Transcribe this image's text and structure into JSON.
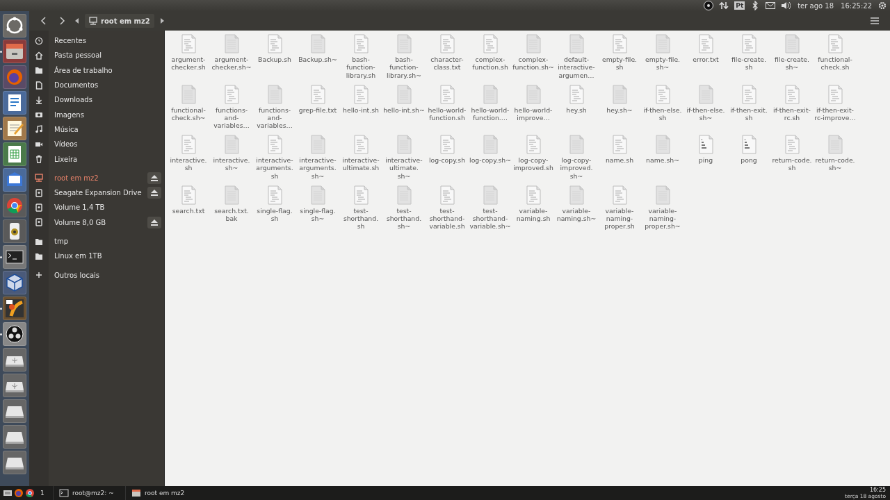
{
  "top_bar": {
    "indicators": [
      {
        "kind": "obs"
      },
      {
        "kind": "network"
      },
      {
        "kind": "keyboard",
        "label": "Pt"
      },
      {
        "kind": "bluetooth"
      },
      {
        "kind": "mail"
      },
      {
        "kind": "volume"
      }
    ],
    "date": "ter ago 18",
    "time": "16:25:22"
  },
  "launcher": [
    {
      "kind": "ubuntu",
      "running": false
    },
    {
      "kind": "files",
      "running": true
    },
    {
      "kind": "firefox",
      "running": false
    },
    {
      "kind": "writer",
      "running": false
    },
    {
      "kind": "editor",
      "running": true
    },
    {
      "kind": "calc",
      "running": false
    },
    {
      "kind": "mail",
      "running": false
    },
    {
      "kind": "chrome",
      "running": false
    },
    {
      "kind": "speaker",
      "running": false
    },
    {
      "kind": "terminal",
      "running": true
    },
    {
      "kind": "vbox",
      "running": false
    },
    {
      "kind": "app64",
      "running": true
    },
    {
      "kind": "obs",
      "running": true
    },
    {
      "kind": "usb",
      "running": false
    },
    {
      "kind": "usb",
      "running": false
    },
    {
      "kind": "drive",
      "running": false
    },
    {
      "kind": "drive",
      "running": false
    },
    {
      "kind": "drive",
      "running": false
    }
  ],
  "header": {
    "path": "root em mz2"
  },
  "sidebar": {
    "groups": [
      [
        {
          "kind": "recent",
          "label": "Recentes",
          "selected": false,
          "eject": false
        },
        {
          "kind": "home",
          "label": "Pasta pessoal",
          "selected": false,
          "eject": false
        },
        {
          "kind": "folder",
          "label": "Área de trabalho",
          "selected": false,
          "eject": false
        },
        {
          "kind": "document",
          "label": "Documentos",
          "selected": false,
          "eject": false
        },
        {
          "kind": "download",
          "label": "Downloads",
          "selected": false,
          "eject": false
        },
        {
          "kind": "camera",
          "label": "Imagens",
          "selected": false,
          "eject": false
        },
        {
          "kind": "music",
          "label": "Música",
          "selected": false,
          "eject": false
        },
        {
          "kind": "video",
          "label": "Vídeos",
          "selected": false,
          "eject": false
        },
        {
          "kind": "trash",
          "label": "Lixeira",
          "selected": false,
          "eject": false
        }
      ],
      [
        {
          "kind": "network",
          "label": "root em mz2",
          "selected": true,
          "eject": true
        },
        {
          "kind": "drive",
          "label": "Seagate Expansion Drive",
          "selected": false,
          "eject": true
        },
        {
          "kind": "drive",
          "label": "Volume 1,4 TB",
          "selected": false,
          "eject": false
        },
        {
          "kind": "drive",
          "label": "Volume 8,0 GB",
          "selected": false,
          "eject": true
        }
      ],
      [
        {
          "kind": "folder",
          "label": "tmp",
          "selected": false,
          "eject": false
        },
        {
          "kind": "folder",
          "label": "Linux em 1TB",
          "selected": false,
          "eject": false
        }
      ],
      [
        {
          "kind": "plus",
          "label": "Outros locais",
          "selected": false,
          "eject": false
        }
      ]
    ]
  },
  "files": [
    {
      "name": "argument-checker.sh",
      "kind": "text"
    },
    {
      "name": "argument-checker.sh~",
      "kind": "plain"
    },
    {
      "name": "Backup.sh",
      "kind": "text"
    },
    {
      "name": "Backup.sh~",
      "kind": "plain"
    },
    {
      "name": "bash-function-library.sh",
      "kind": "text"
    },
    {
      "name": "bash-function-library.sh~",
      "kind": "plain"
    },
    {
      "name": "character-class.txt",
      "kind": "text"
    },
    {
      "name": "complex-function.sh",
      "kind": "text"
    },
    {
      "name": "complex-function.sh~",
      "kind": "plain"
    },
    {
      "name": "default-interactive-argumen…",
      "kind": "plain"
    },
    {
      "name": "empty-file.sh",
      "kind": "text"
    },
    {
      "name": "empty-file.sh~",
      "kind": "plain"
    },
    {
      "name": "error.txt",
      "kind": "text"
    },
    {
      "name": "file-create.sh",
      "kind": "text"
    },
    {
      "name": "file-create.sh~",
      "kind": "plain"
    },
    {
      "name": "functional-check.sh",
      "kind": "text"
    },
    {
      "name": "functional-check.sh~",
      "kind": "plain"
    },
    {
      "name": "functions-and-variables…",
      "kind": "text"
    },
    {
      "name": "functions-and-variables…",
      "kind": "plain"
    },
    {
      "name": "grep-file.txt",
      "kind": "text"
    },
    {
      "name": "hello-int.sh",
      "kind": "text"
    },
    {
      "name": "hello-int.sh~",
      "kind": "plain"
    },
    {
      "name": "hello-world-function.sh",
      "kind": "text"
    },
    {
      "name": "hello-world-function.…",
      "kind": "plain"
    },
    {
      "name": "hello-world-improve…",
      "kind": "plain"
    },
    {
      "name": "hey.sh",
      "kind": "text"
    },
    {
      "name": "hey.sh~",
      "kind": "plain"
    },
    {
      "name": "if-then-else.sh",
      "kind": "text"
    },
    {
      "name": "if-then-else.sh~",
      "kind": "plain"
    },
    {
      "name": "if-then-exit.sh",
      "kind": "text"
    },
    {
      "name": "if-then-exit-rc.sh",
      "kind": "text"
    },
    {
      "name": "if-then-exit-rc-improve…",
      "kind": "text"
    },
    {
      "name": "interactive.sh",
      "kind": "text"
    },
    {
      "name": "interactive.sh~",
      "kind": "plain"
    },
    {
      "name": "interactive-arguments.sh",
      "kind": "text"
    },
    {
      "name": "interactive-arguments.sh~",
      "kind": "plain"
    },
    {
      "name": "interactive-ultimate.sh",
      "kind": "text"
    },
    {
      "name": "interactive-ultimate.sh~",
      "kind": "plain"
    },
    {
      "name": "log-copy.sh",
      "kind": "text"
    },
    {
      "name": "log-copy.sh~",
      "kind": "plain"
    },
    {
      "name": "log-copy-improved.sh",
      "kind": "text"
    },
    {
      "name": "log-copy-improved.sh~",
      "kind": "plain"
    },
    {
      "name": "name.sh",
      "kind": "text"
    },
    {
      "name": "name.sh~",
      "kind": "plain"
    },
    {
      "name": "ping",
      "kind": "binary"
    },
    {
      "name": "pong",
      "kind": "binary"
    },
    {
      "name": "return-code.sh",
      "kind": "text"
    },
    {
      "name": "return-code.sh~",
      "kind": "plain"
    },
    {
      "name": "search.txt",
      "kind": "text"
    },
    {
      "name": "search.txt.bak",
      "kind": "plain"
    },
    {
      "name": "single-flag.sh",
      "kind": "text"
    },
    {
      "name": "single-flag.sh~",
      "kind": "plain"
    },
    {
      "name": "test-shorthand.sh",
      "kind": "text"
    },
    {
      "name": "test-shorthand.sh~",
      "kind": "plain"
    },
    {
      "name": "test-shorthand-variable.sh",
      "kind": "text"
    },
    {
      "name": "test-shorthand-variable.sh~",
      "kind": "plain"
    },
    {
      "name": "variable-naming.sh",
      "kind": "text"
    },
    {
      "name": "variable-naming.sh~",
      "kind": "plain"
    },
    {
      "name": "variable-naming-proper.sh",
      "kind": "text"
    },
    {
      "name": "variable-naming-proper.sh~",
      "kind": "plain"
    }
  ],
  "taskbar": {
    "quick": [
      {
        "kind": "keyboard"
      },
      {
        "kind": "firefox"
      },
      {
        "kind": "chrome"
      }
    ],
    "workspace": "1",
    "windows": [
      {
        "kind": "terminal",
        "title": "root@mz2: ~"
      },
      {
        "kind": "files",
        "title": "root em mz2"
      }
    ],
    "clock_time": "16:25",
    "clock_date": "terça 18 agosto"
  }
}
